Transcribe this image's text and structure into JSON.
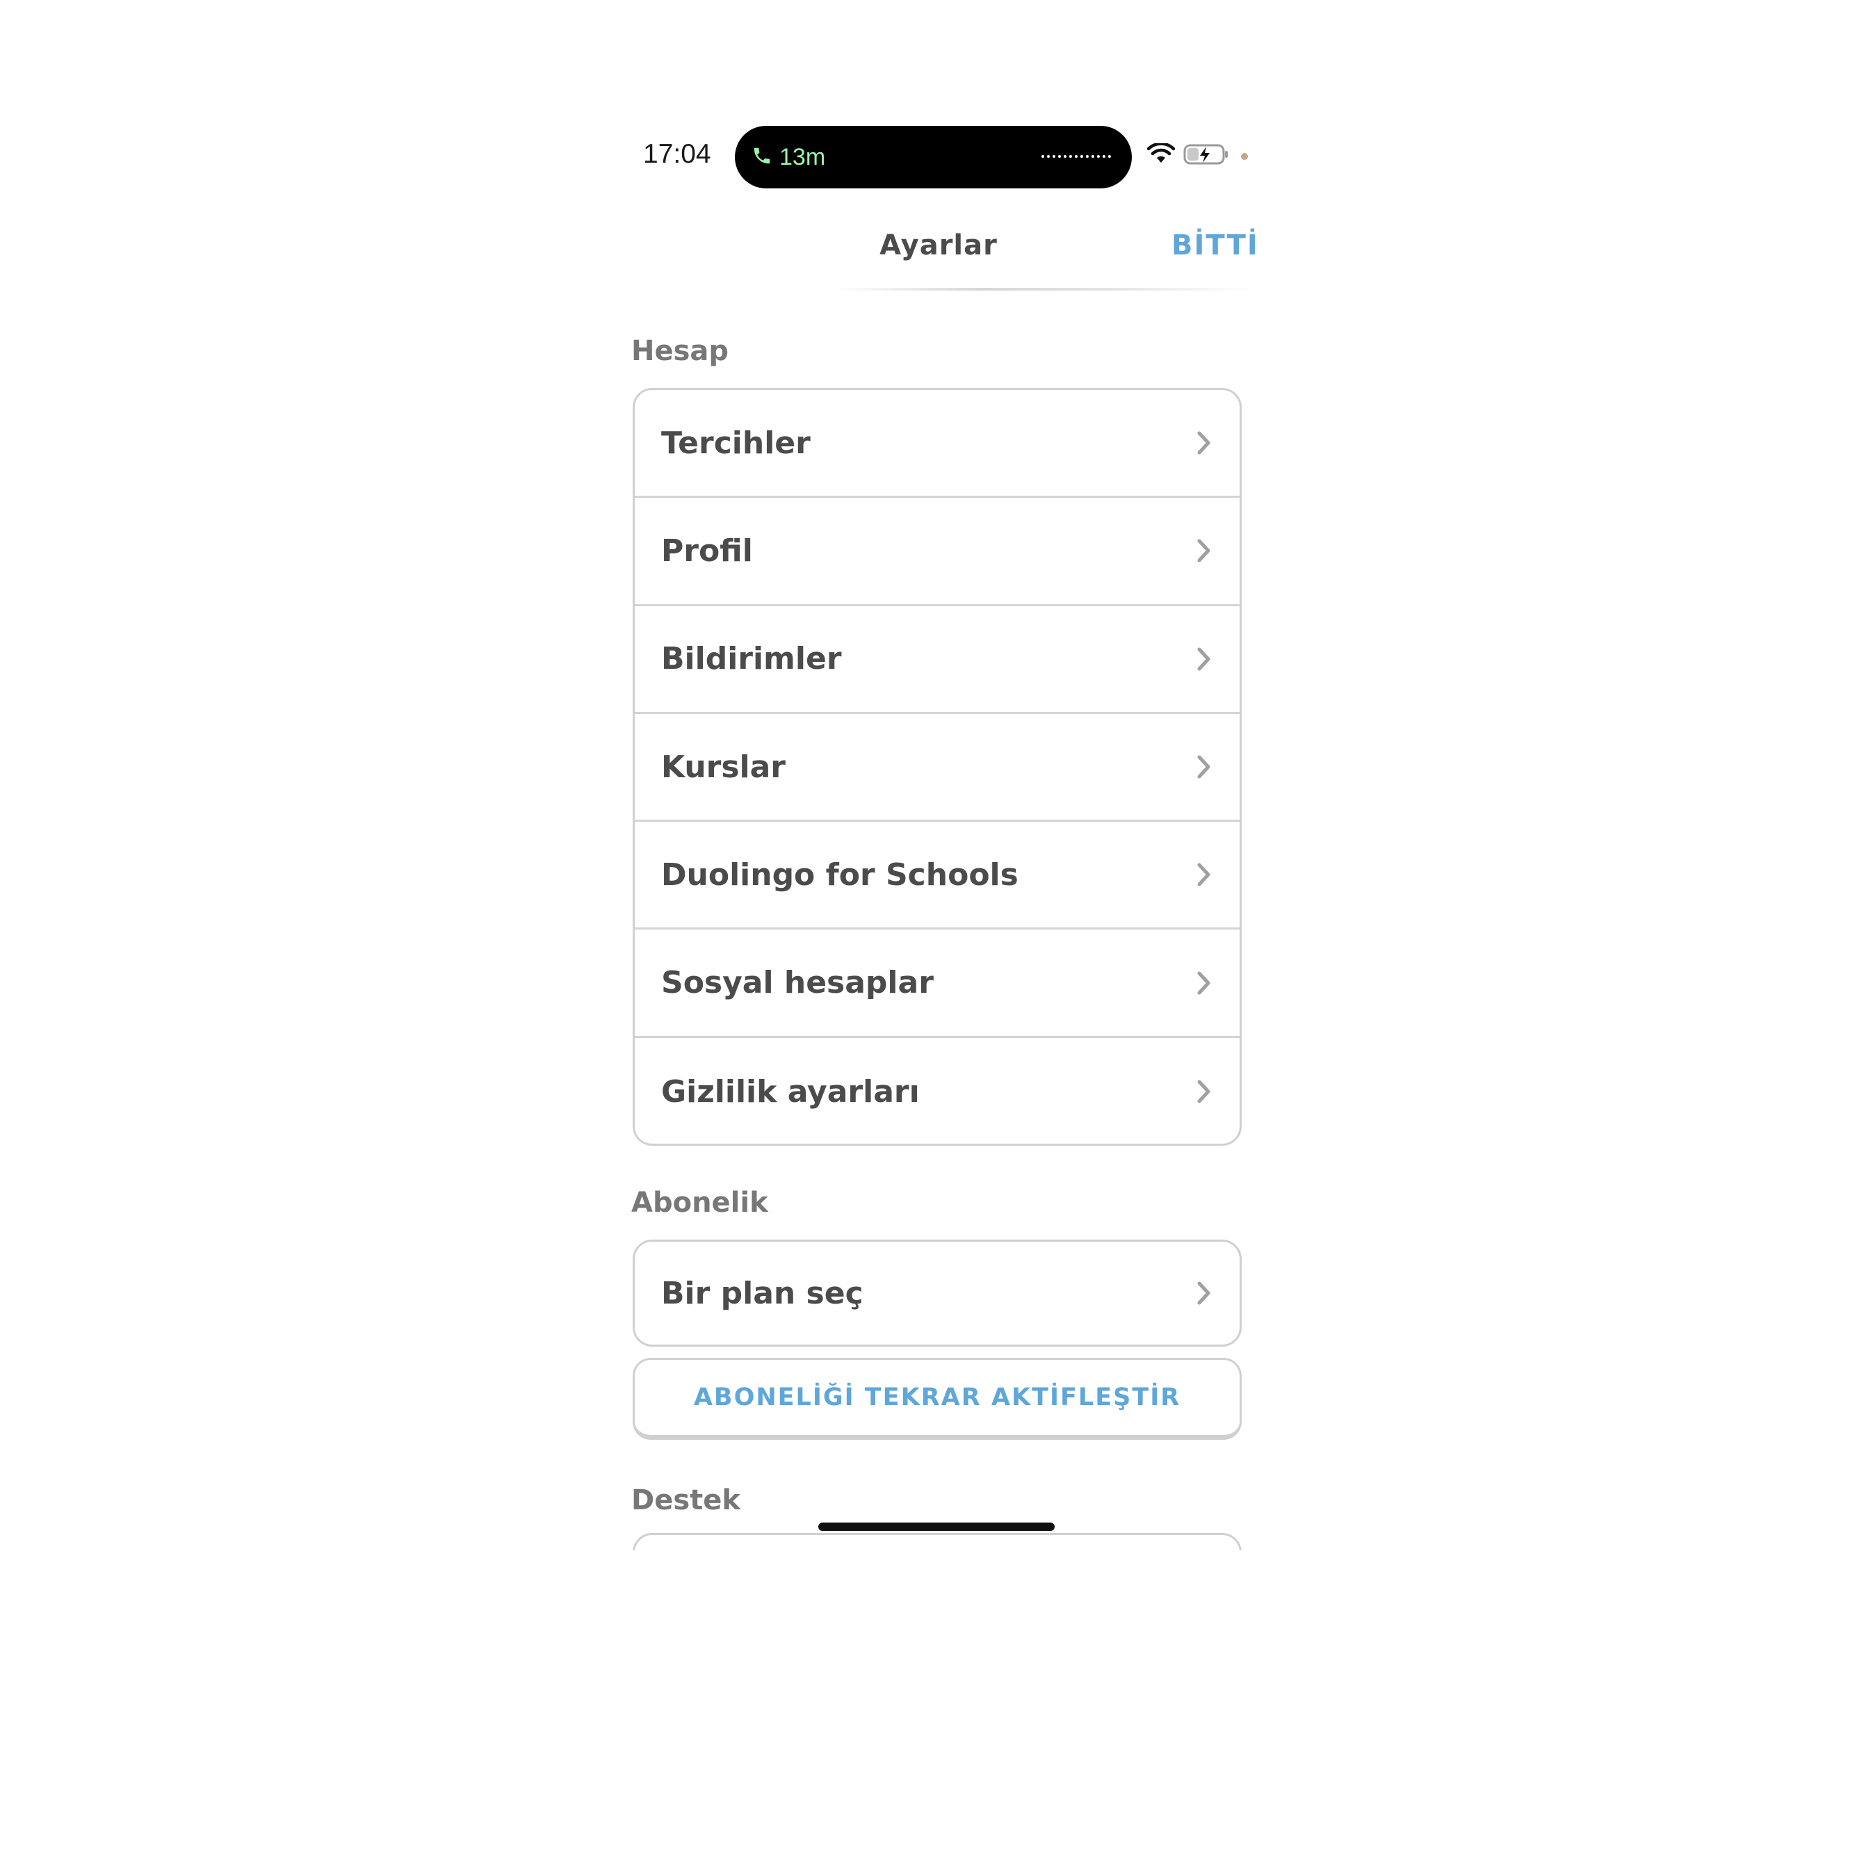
{
  "status_bar": {
    "time": "17:04",
    "call_duration": "13m",
    "icons": [
      "phone-icon",
      "wifi-icon",
      "battery-charging-icon"
    ]
  },
  "nav": {
    "title": "Ayarlar",
    "done_label": "BİTTİ"
  },
  "sections": {
    "account": {
      "header": "Hesap",
      "items": [
        {
          "label": "Tercihler"
        },
        {
          "label": "Profil"
        },
        {
          "label": "Bildirimler"
        },
        {
          "label": "Kurslar"
        },
        {
          "label": "Duolingo for Schools"
        },
        {
          "label": "Sosyal hesaplar"
        },
        {
          "label": "Gizlilik ayarları"
        }
      ]
    },
    "subscription": {
      "header": "Abonelik",
      "items": [
        {
          "label": "Bir plan seç"
        }
      ],
      "reactivate_label": "ABONELİĞİ TEKRAR AKTİFLEŞTİR"
    },
    "support": {
      "header": "Destek"
    }
  },
  "colors": {
    "accent": "#5fa6d9",
    "text": "#4b4b4b",
    "section_header": "#777777",
    "border": "#d0d0d0"
  }
}
